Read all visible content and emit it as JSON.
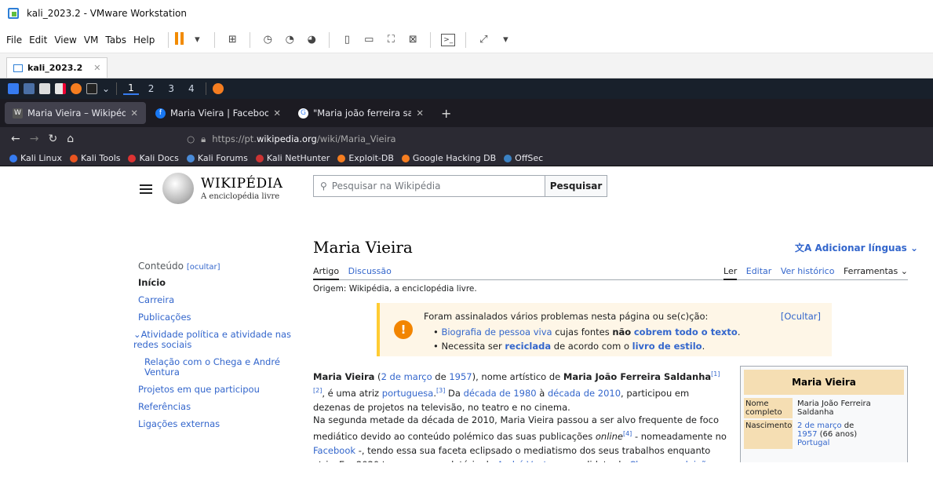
{
  "vmware": {
    "title": "kali_2023.2 - VMware Workstation",
    "menu": [
      "File",
      "Edit",
      "View",
      "VM",
      "Tabs",
      "Help"
    ],
    "tab_label": "kali_2023.2"
  },
  "kali_panel": {
    "workspaces": [
      "1",
      "2",
      "3",
      "4"
    ]
  },
  "firefox": {
    "tabs": [
      {
        "title": "Maria Vieira – Wikipédia, a",
        "favicon": "W",
        "color": "#555"
      },
      {
        "title": "Maria Vieira | Facebook",
        "favicon": "f",
        "color": "#1877f2"
      },
      {
        "title": "\"Maria joão ferreira saldan",
        "favicon": "G",
        "color": "#34a853"
      }
    ],
    "url_prefix": "https://pt.",
    "url_domain": "wikipedia.org",
    "url_path": "/wiki/Maria_Vieira",
    "bookmarks": [
      "Kali Linux",
      "Kali Tools",
      "Kali Docs",
      "Kali Forums",
      "Kali NetHunter",
      "Exploit-DB",
      "Google Hacking DB",
      "OffSec"
    ]
  },
  "wiki": {
    "logo_name": "WIKIPÉDIA",
    "logo_tagline": "A enciclopédia livre",
    "search_placeholder": "Pesquisar na Wikipédia",
    "search_button": "Pesquisar",
    "article_title": "Maria Vieira",
    "add_languages": "Adicionar línguas",
    "tab_article": "Artigo",
    "tab_discussion": "Discussão",
    "action_read": "Ler",
    "action_edit": "Editar",
    "action_history": "Ver histórico",
    "action_tools": "Ferramentas",
    "origin": "Origem: Wikipédia, a enciclopédia livre.",
    "toc_title": "Conteúdo",
    "toc_hide": "[ocultar]",
    "toc": [
      "Início",
      "Carreira",
      "Publicações",
      "Atividade política e atividade nas redes sociais",
      "Relação com o Chega e André Ventura",
      "Projetos em que participou",
      "Referências",
      "Ligações externas"
    ],
    "notice_title": "Foram assinalados vários problemas nesta página ou se(c)ção:",
    "notice_hide": "[Ocultar]",
    "notice_b1_link": "Biografia de pessoa viva",
    "notice_b1_text": " cujas fontes ",
    "notice_b1_bold": "não",
    "notice_b1_link2": "cobrem todo o texto",
    "notice_b2_text": "Necessita ser ",
    "notice_b2_link": "reciclada",
    "notice_b2_text2": " de acordo com o ",
    "notice_b2_link2": "livro de estilo",
    "infobox_title": "Maria Vieira",
    "infobox_k1": "Nome completo",
    "infobox_v1": "Maria João Ferreira Saldanha",
    "infobox_k2": "Nascimento",
    "infobox_v2_link": "2 de março",
    "infobox_v2_text": " de ",
    "infobox_v2_year": "1957",
    "infobox_v2_age": " (66 anos)",
    "infobox_v2_country": "Portugal"
  }
}
